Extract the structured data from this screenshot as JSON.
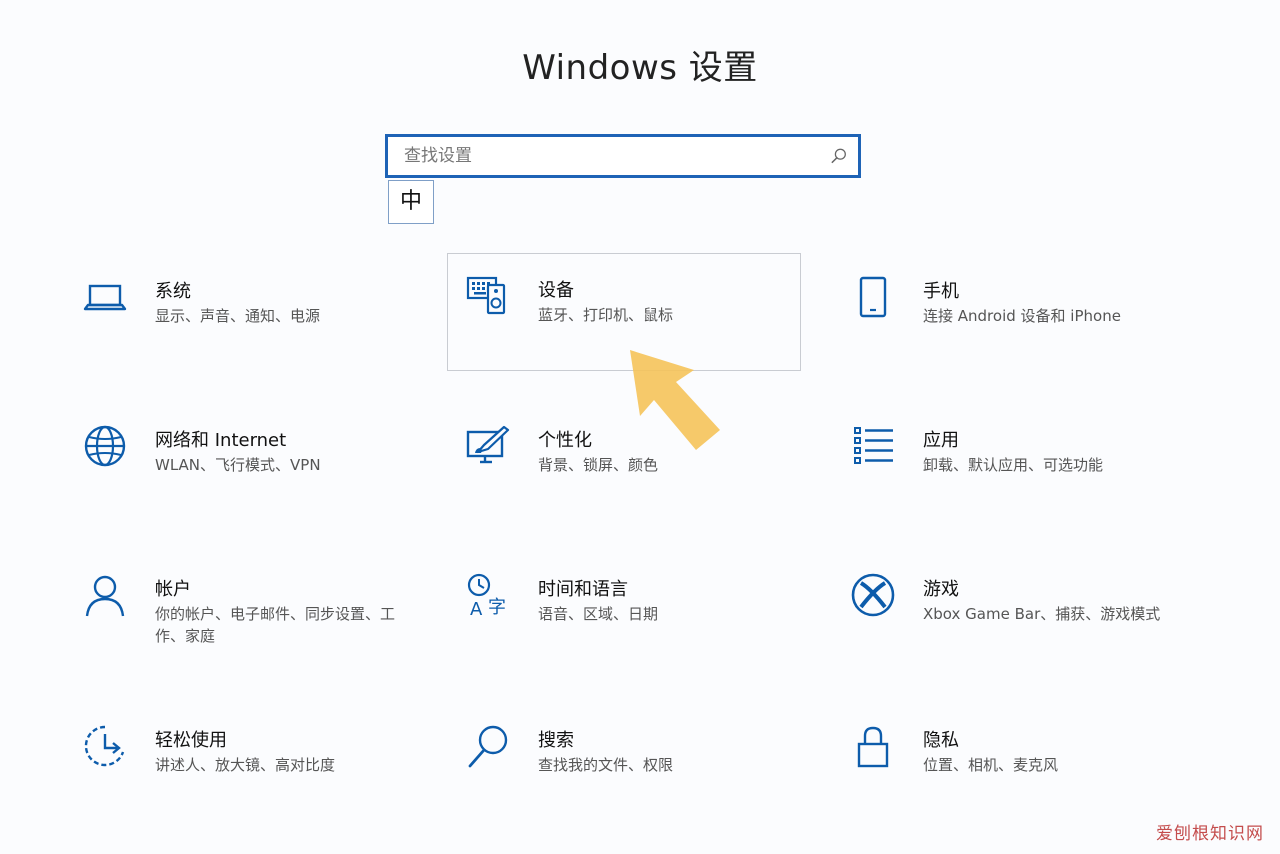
{
  "window": {
    "title": "Windows 设置"
  },
  "search": {
    "placeholder": "查找设置",
    "value": "",
    "ime_indicator": "中"
  },
  "tiles": [
    {
      "name": "系统",
      "desc": "显示、声音、通知、电源",
      "icon": "laptop-icon"
    },
    {
      "name": "设备",
      "desc": "蓝牙、打印机、鼠标",
      "icon": "devices-icon",
      "selected": true
    },
    {
      "name": "手机",
      "desc": "连接 Android 设备和 iPhone",
      "icon": "phone-icon"
    },
    {
      "name": "网络和 Internet",
      "desc": "WLAN、飞行模式、VPN",
      "icon": "globe-icon"
    },
    {
      "name": "个性化",
      "desc": "背景、锁屏、颜色",
      "icon": "personalization-icon"
    },
    {
      "name": "应用",
      "desc": "卸载、默认应用、可选功能",
      "icon": "apps-list-icon"
    },
    {
      "name": "帐户",
      "desc": "你的帐户、电子邮件、同步设置、工作、家庭",
      "icon": "person-icon"
    },
    {
      "name": "时间和语言",
      "desc": "语音、区域、日期",
      "icon": "time-language-icon"
    },
    {
      "name": "游戏",
      "desc": "Xbox Game Bar、捕获、游戏模式",
      "icon": "xbox-icon"
    },
    {
      "name": "轻松使用",
      "desc": "讲述人、放大镜、高对比度",
      "icon": "ease-of-access-icon"
    },
    {
      "name": "搜索",
      "desc": "查找我的文件、权限",
      "icon": "search-magnifier-icon"
    },
    {
      "name": "隐私",
      "desc": "位置、相机、麦克风",
      "icon": "lock-icon"
    }
  ],
  "colors": {
    "accent": "#1e63b6",
    "icon": "#0d5cab",
    "arrow": "#f5c35a",
    "background": "#fbfcfe"
  },
  "watermark": "爱刨根知识网"
}
